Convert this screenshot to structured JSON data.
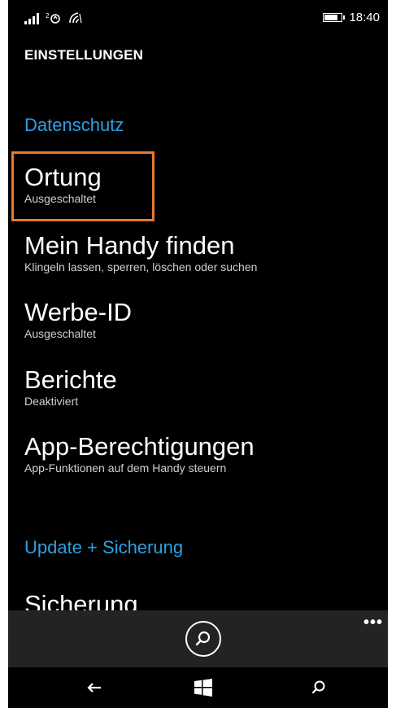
{
  "status": {
    "time": "18:40",
    "battery_level": 0.7
  },
  "header": {
    "title": "EINSTELLUNGEN"
  },
  "sections": [
    {
      "heading": "Datenschutz"
    },
    {
      "heading": "Update + Sicherung"
    }
  ],
  "items": [
    {
      "title": "Ortung",
      "subtitle": "Ausgeschaltet"
    },
    {
      "title": "Mein Handy finden",
      "subtitle": "Klingeln lassen, sperren, löschen oder suchen"
    },
    {
      "title": "Werbe-ID",
      "subtitle": "Ausgeschaltet"
    },
    {
      "title": "Berichte",
      "subtitle": "Deaktiviert"
    },
    {
      "title": "App-Berechtigungen",
      "subtitle": "App-Funktionen auf dem Handy steuern"
    },
    {
      "title": "Sicherung",
      "subtitle": ""
    }
  ],
  "appbar": {
    "more": "•••",
    "button_icon": "search-circle-icon"
  },
  "navbar": {
    "back_icon": "back-arrow-icon",
    "home_icon": "windows-logo-icon",
    "search_icon": "search-icon"
  },
  "colors": {
    "accent": "#2f9fe0",
    "highlight": "#e77a2a",
    "appbar_bg": "#232323"
  }
}
